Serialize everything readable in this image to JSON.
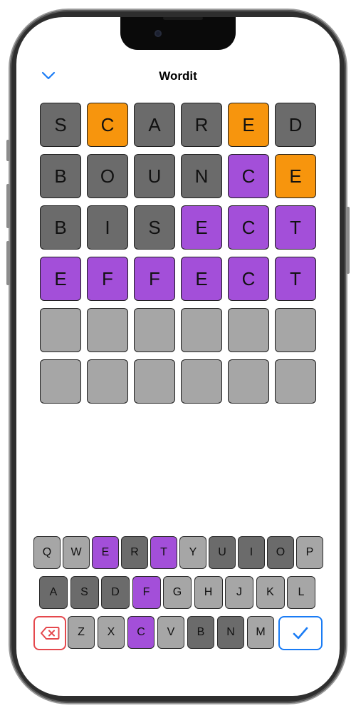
{
  "app": {
    "title": "Wordit"
  },
  "colors": {
    "correct": "#a34fd9",
    "present": "#f7950d",
    "absent": "#6b6b6b",
    "unused": "#a6a6a6",
    "accent": "#1a7cf5",
    "delete": "#e5484d"
  },
  "board": {
    "rows": [
      [
        {
          "letter": "S",
          "state": "absent"
        },
        {
          "letter": "C",
          "state": "present"
        },
        {
          "letter": "A",
          "state": "absent"
        },
        {
          "letter": "R",
          "state": "absent"
        },
        {
          "letter": "E",
          "state": "present"
        },
        {
          "letter": "D",
          "state": "absent"
        }
      ],
      [
        {
          "letter": "B",
          "state": "absent"
        },
        {
          "letter": "O",
          "state": "absent"
        },
        {
          "letter": "U",
          "state": "absent"
        },
        {
          "letter": "N",
          "state": "absent"
        },
        {
          "letter": "C",
          "state": "correct"
        },
        {
          "letter": "E",
          "state": "present"
        }
      ],
      [
        {
          "letter": "B",
          "state": "absent"
        },
        {
          "letter": "I",
          "state": "absent"
        },
        {
          "letter": "S",
          "state": "absent"
        },
        {
          "letter": "E",
          "state": "correct"
        },
        {
          "letter": "C",
          "state": "correct"
        },
        {
          "letter": "T",
          "state": "correct"
        }
      ],
      [
        {
          "letter": "E",
          "state": "correct"
        },
        {
          "letter": "F",
          "state": "correct"
        },
        {
          "letter": "F",
          "state": "correct"
        },
        {
          "letter": "E",
          "state": "correct"
        },
        {
          "letter": "C",
          "state": "correct"
        },
        {
          "letter": "T",
          "state": "correct"
        }
      ],
      [
        {
          "letter": "",
          "state": "empty"
        },
        {
          "letter": "",
          "state": "empty"
        },
        {
          "letter": "",
          "state": "empty"
        },
        {
          "letter": "",
          "state": "empty"
        },
        {
          "letter": "",
          "state": "empty"
        },
        {
          "letter": "",
          "state": "empty"
        }
      ],
      [
        {
          "letter": "",
          "state": "empty"
        },
        {
          "letter": "",
          "state": "empty"
        },
        {
          "letter": "",
          "state": "empty"
        },
        {
          "letter": "",
          "state": "empty"
        },
        {
          "letter": "",
          "state": "empty"
        },
        {
          "letter": "",
          "state": "empty"
        }
      ]
    ]
  },
  "keyboard": {
    "row1": [
      {
        "key": "Q",
        "state": "unused"
      },
      {
        "key": "W",
        "state": "unused"
      },
      {
        "key": "E",
        "state": "correct"
      },
      {
        "key": "R",
        "state": "absent"
      },
      {
        "key": "T",
        "state": "correct"
      },
      {
        "key": "Y",
        "state": "unused"
      },
      {
        "key": "U",
        "state": "absent"
      },
      {
        "key": "I",
        "state": "absent"
      },
      {
        "key": "O",
        "state": "absent"
      },
      {
        "key": "P",
        "state": "unused"
      }
    ],
    "row2": [
      {
        "key": "A",
        "state": "absent"
      },
      {
        "key": "S",
        "state": "absent"
      },
      {
        "key": "D",
        "state": "absent"
      },
      {
        "key": "F",
        "state": "correct"
      },
      {
        "key": "G",
        "state": "unused"
      },
      {
        "key": "H",
        "state": "unused"
      },
      {
        "key": "J",
        "state": "unused"
      },
      {
        "key": "K",
        "state": "unused"
      },
      {
        "key": "L",
        "state": "unused"
      }
    ],
    "row3": [
      {
        "key": "Z",
        "state": "unused"
      },
      {
        "key": "X",
        "state": "unused"
      },
      {
        "key": "C",
        "state": "correct"
      },
      {
        "key": "V",
        "state": "unused"
      },
      {
        "key": "B",
        "state": "absent"
      },
      {
        "key": "N",
        "state": "absent"
      },
      {
        "key": "M",
        "state": "unused"
      }
    ],
    "delete_icon": "delete-backspace-icon",
    "submit_icon": "checkmark-icon"
  },
  "nav": {
    "back_icon": "chevron-down-icon"
  }
}
